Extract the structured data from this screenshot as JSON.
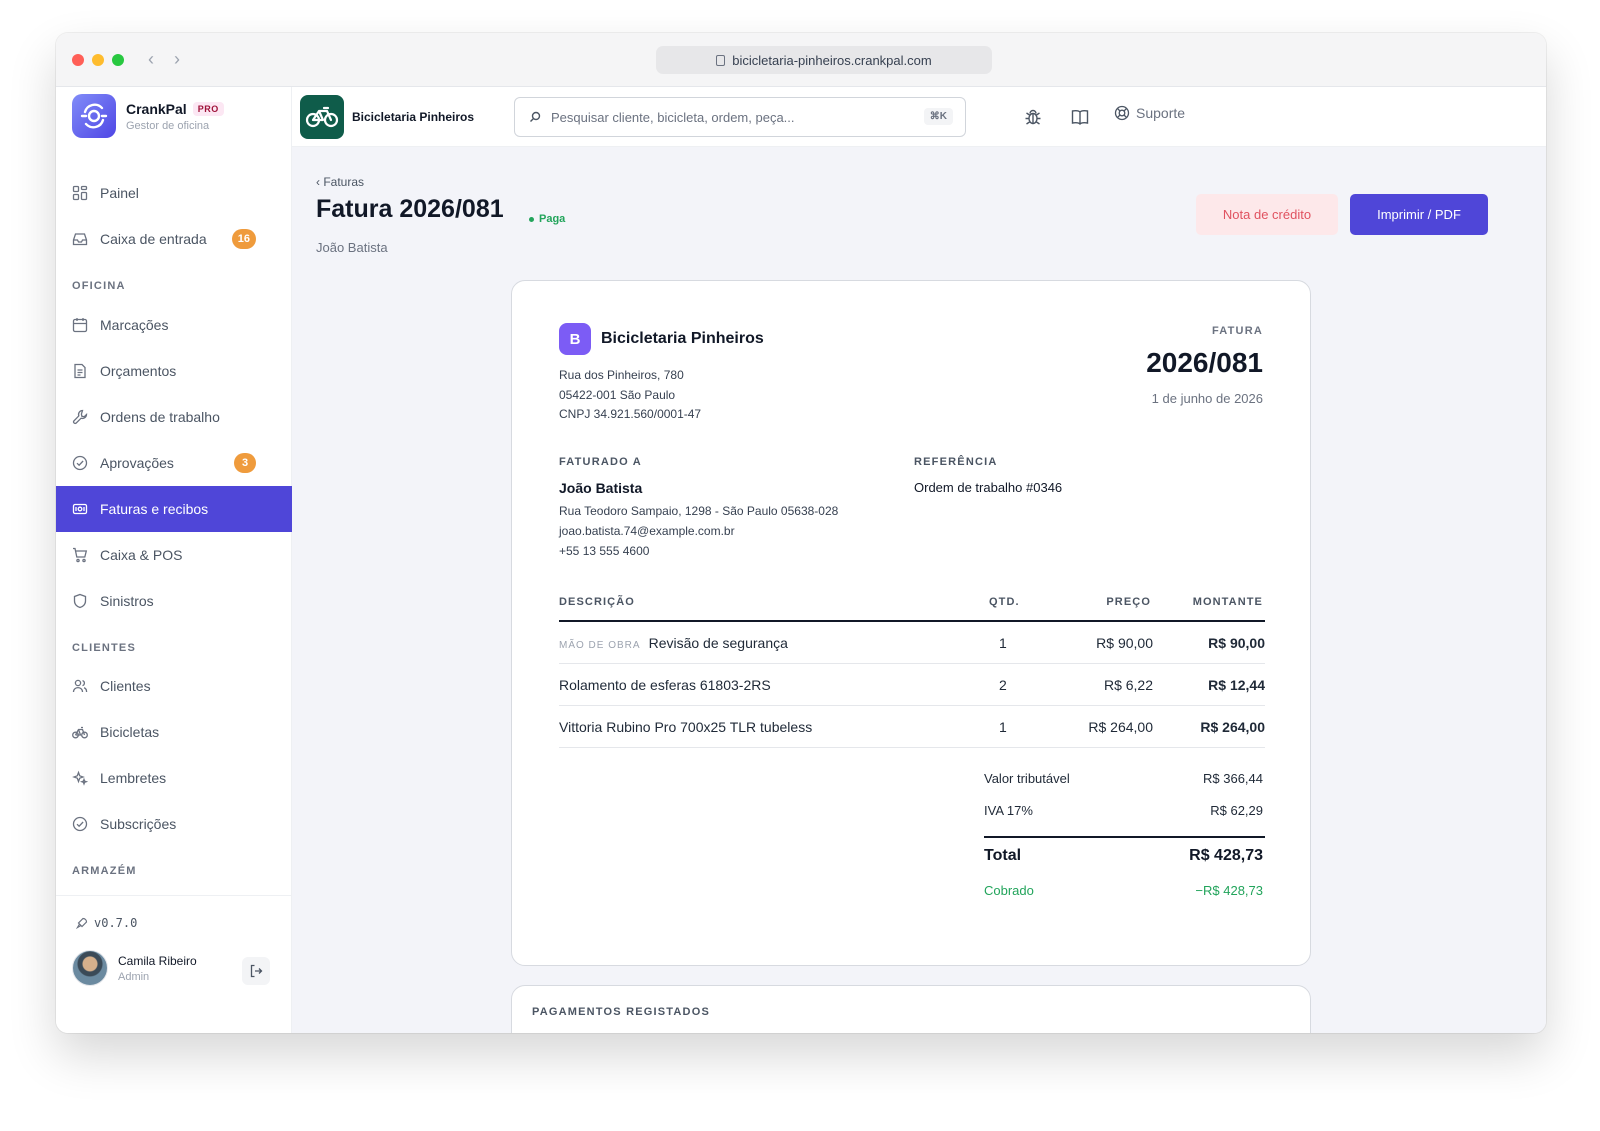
{
  "browser": {
    "url": "bicicletaria-pinheiros.crankpal.com"
  },
  "brand": {
    "name": "CrankPal",
    "badge": "PRO",
    "subtitle": "Gestor de oficina"
  },
  "tenant": {
    "name": "Bicicletaria Pinheiros"
  },
  "search": {
    "placeholder": "Pesquisar cliente, bicicleta, ordem, peça...",
    "shortcut": "⌘K"
  },
  "topbar": {
    "support_label": "Suporte"
  },
  "sidebar": {
    "items": [
      {
        "label": "Painel",
        "icon": "dashboard-icon"
      },
      {
        "label": "Caixa de entrada",
        "icon": "inbox-icon",
        "badge": "16"
      }
    ],
    "section_oficina": "OFICINA",
    "oficina": [
      {
        "label": "Marcações",
        "icon": "calendar-icon"
      },
      {
        "label": "Orçamentos",
        "icon": "document-icon"
      },
      {
        "label": "Ordens de trabalho",
        "icon": "wrench-icon"
      },
      {
        "label": "Aprovações",
        "icon": "check-circle-icon",
        "badge": "3"
      },
      {
        "label": "Faturas e recibos",
        "icon": "receipt-icon",
        "active": true
      },
      {
        "label": "Caixa & POS",
        "icon": "cart-icon"
      },
      {
        "label": "Sinistros",
        "icon": "shield-icon"
      }
    ],
    "section_clientes": "CLIENTES",
    "clientes": [
      {
        "label": "Clientes",
        "icon": "users-icon"
      },
      {
        "label": "Bicicletas",
        "icon": "bicycle-icon"
      },
      {
        "label": "Lembretes",
        "icon": "sparkles-icon"
      },
      {
        "label": "Subscrições",
        "icon": "check-circle-icon"
      }
    ],
    "section_armazem": "ARMAZÉM",
    "version": "v0.7.0",
    "user": {
      "name": "Camila Ribeiro",
      "role": "Admin"
    }
  },
  "page": {
    "breadcrumb": "‹ Faturas",
    "title": "Fatura 2026/081",
    "status": "Paga",
    "subtitle": "João Batista",
    "credit_note_button": "Nota de crédito",
    "print_button": "Imprimir / PDF"
  },
  "invoice": {
    "company": {
      "initial": "B",
      "name": "Bicicletaria Pinheiros",
      "address1": "Rua dos Pinheiros, 780",
      "address2": "05422-001 São Paulo",
      "tax_id": "CNPJ 34.921.560/0001-47"
    },
    "label": "FATURA",
    "number": "2026/081",
    "date": "1 de junho de 2026",
    "billed_to_label": "FATURADO A",
    "billed_to": {
      "name": "João Batista",
      "address": "Rua Teodoro Sampaio, 1298 - São Paulo 05638-028",
      "email": "joao.batista.74@example.com.br",
      "phone": "+55 13 555 4600"
    },
    "reference_label": "REFERÊNCIA",
    "reference": "Ordem de trabalho #0346",
    "columns": {
      "description": "DESCRIÇÃO",
      "qty": "QTD.",
      "price": "PREÇO",
      "amount": "MONTANTE"
    },
    "lines": [
      {
        "tag": "MÃO DE OBRA",
        "description": "Revisão de segurança",
        "qty": "1",
        "price": "R$ 90,00",
        "amount": "R$ 90,00"
      },
      {
        "tag": "",
        "description": "Rolamento de esferas 61803-2RS",
        "qty": "2",
        "price": "R$ 6,22",
        "amount": "R$ 12,44"
      },
      {
        "tag": "",
        "description": "Vittoria Rubino Pro 700x25 TLR tubeless",
        "qty": "1",
        "price": "R$ 264,00",
        "amount": "R$ 264,00"
      }
    ],
    "taxable_label": "Valor tributável",
    "taxable_value": "R$ 366,44",
    "vat_label": "IVA 17%",
    "vat_value": "R$ 62,29",
    "total_label": "Total",
    "total_value": "R$ 428,73",
    "charged_label": "Cobrado",
    "charged_value": "−R$ 428,73"
  },
  "payments": {
    "title": "PAGAMENTOS REGISTADOS"
  },
  "colors": {
    "accent": "#4f46d8",
    "paid": "#22a45b",
    "badge": "#ef9b3c",
    "credit": "#e05260"
  }
}
